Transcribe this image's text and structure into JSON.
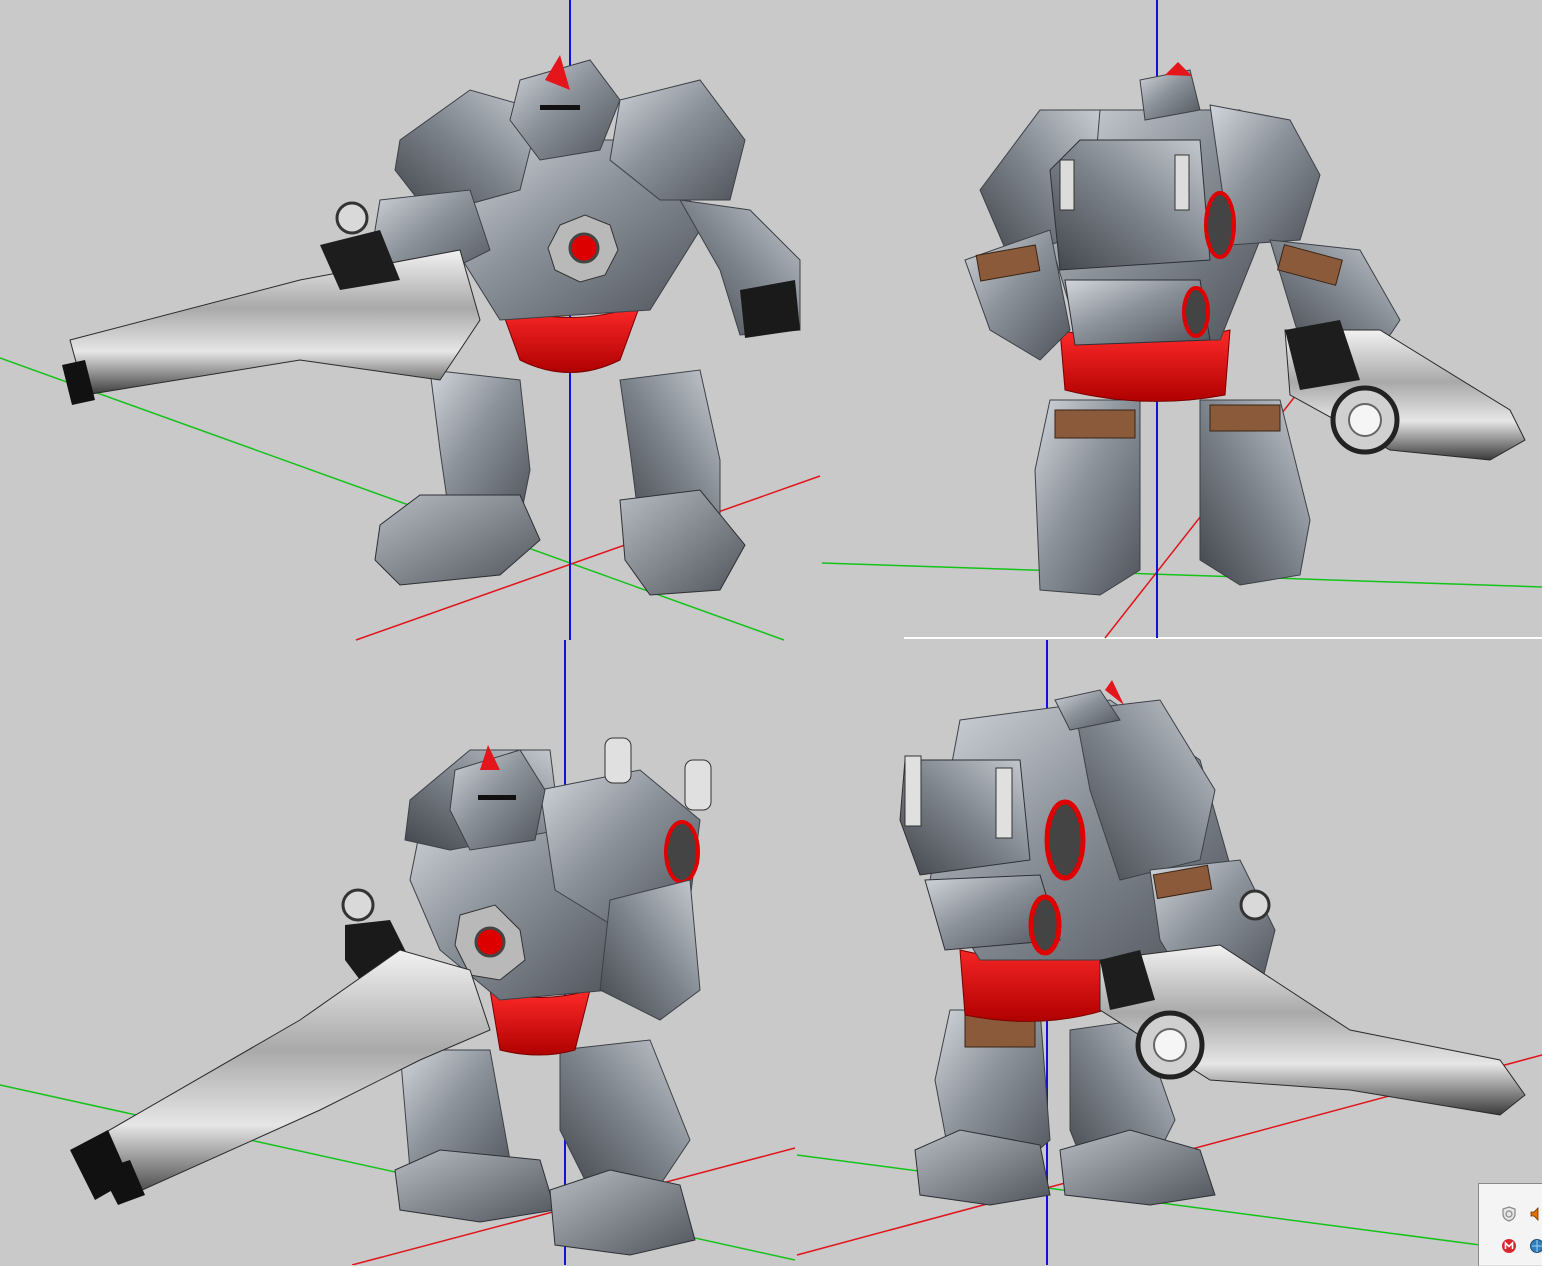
{
  "app": {
    "description_free": true
  },
  "viewports": [
    {
      "id": "front"
    },
    {
      "id": "back"
    },
    {
      "id": "front-three-quarter"
    },
    {
      "id": "back-three-quarter"
    }
  ],
  "axes_colors": {
    "x": "#e0141a",
    "y": "#16c21a",
    "z": "#1010e0"
  },
  "model_colors": {
    "armor": "#8e949c",
    "armor_light": "#c9ced4",
    "armor_dark": "#4c5158",
    "cloth": "#d80a0a",
    "crest": "#e4161c",
    "gun": "#bdbdbd",
    "gun_dark": "#2a2a2a",
    "leather": "#8a5a3a"
  },
  "tray": {
    "icons": [
      "shield-icon",
      "speaker-icon",
      "mega-icon",
      "network-icon"
    ]
  }
}
